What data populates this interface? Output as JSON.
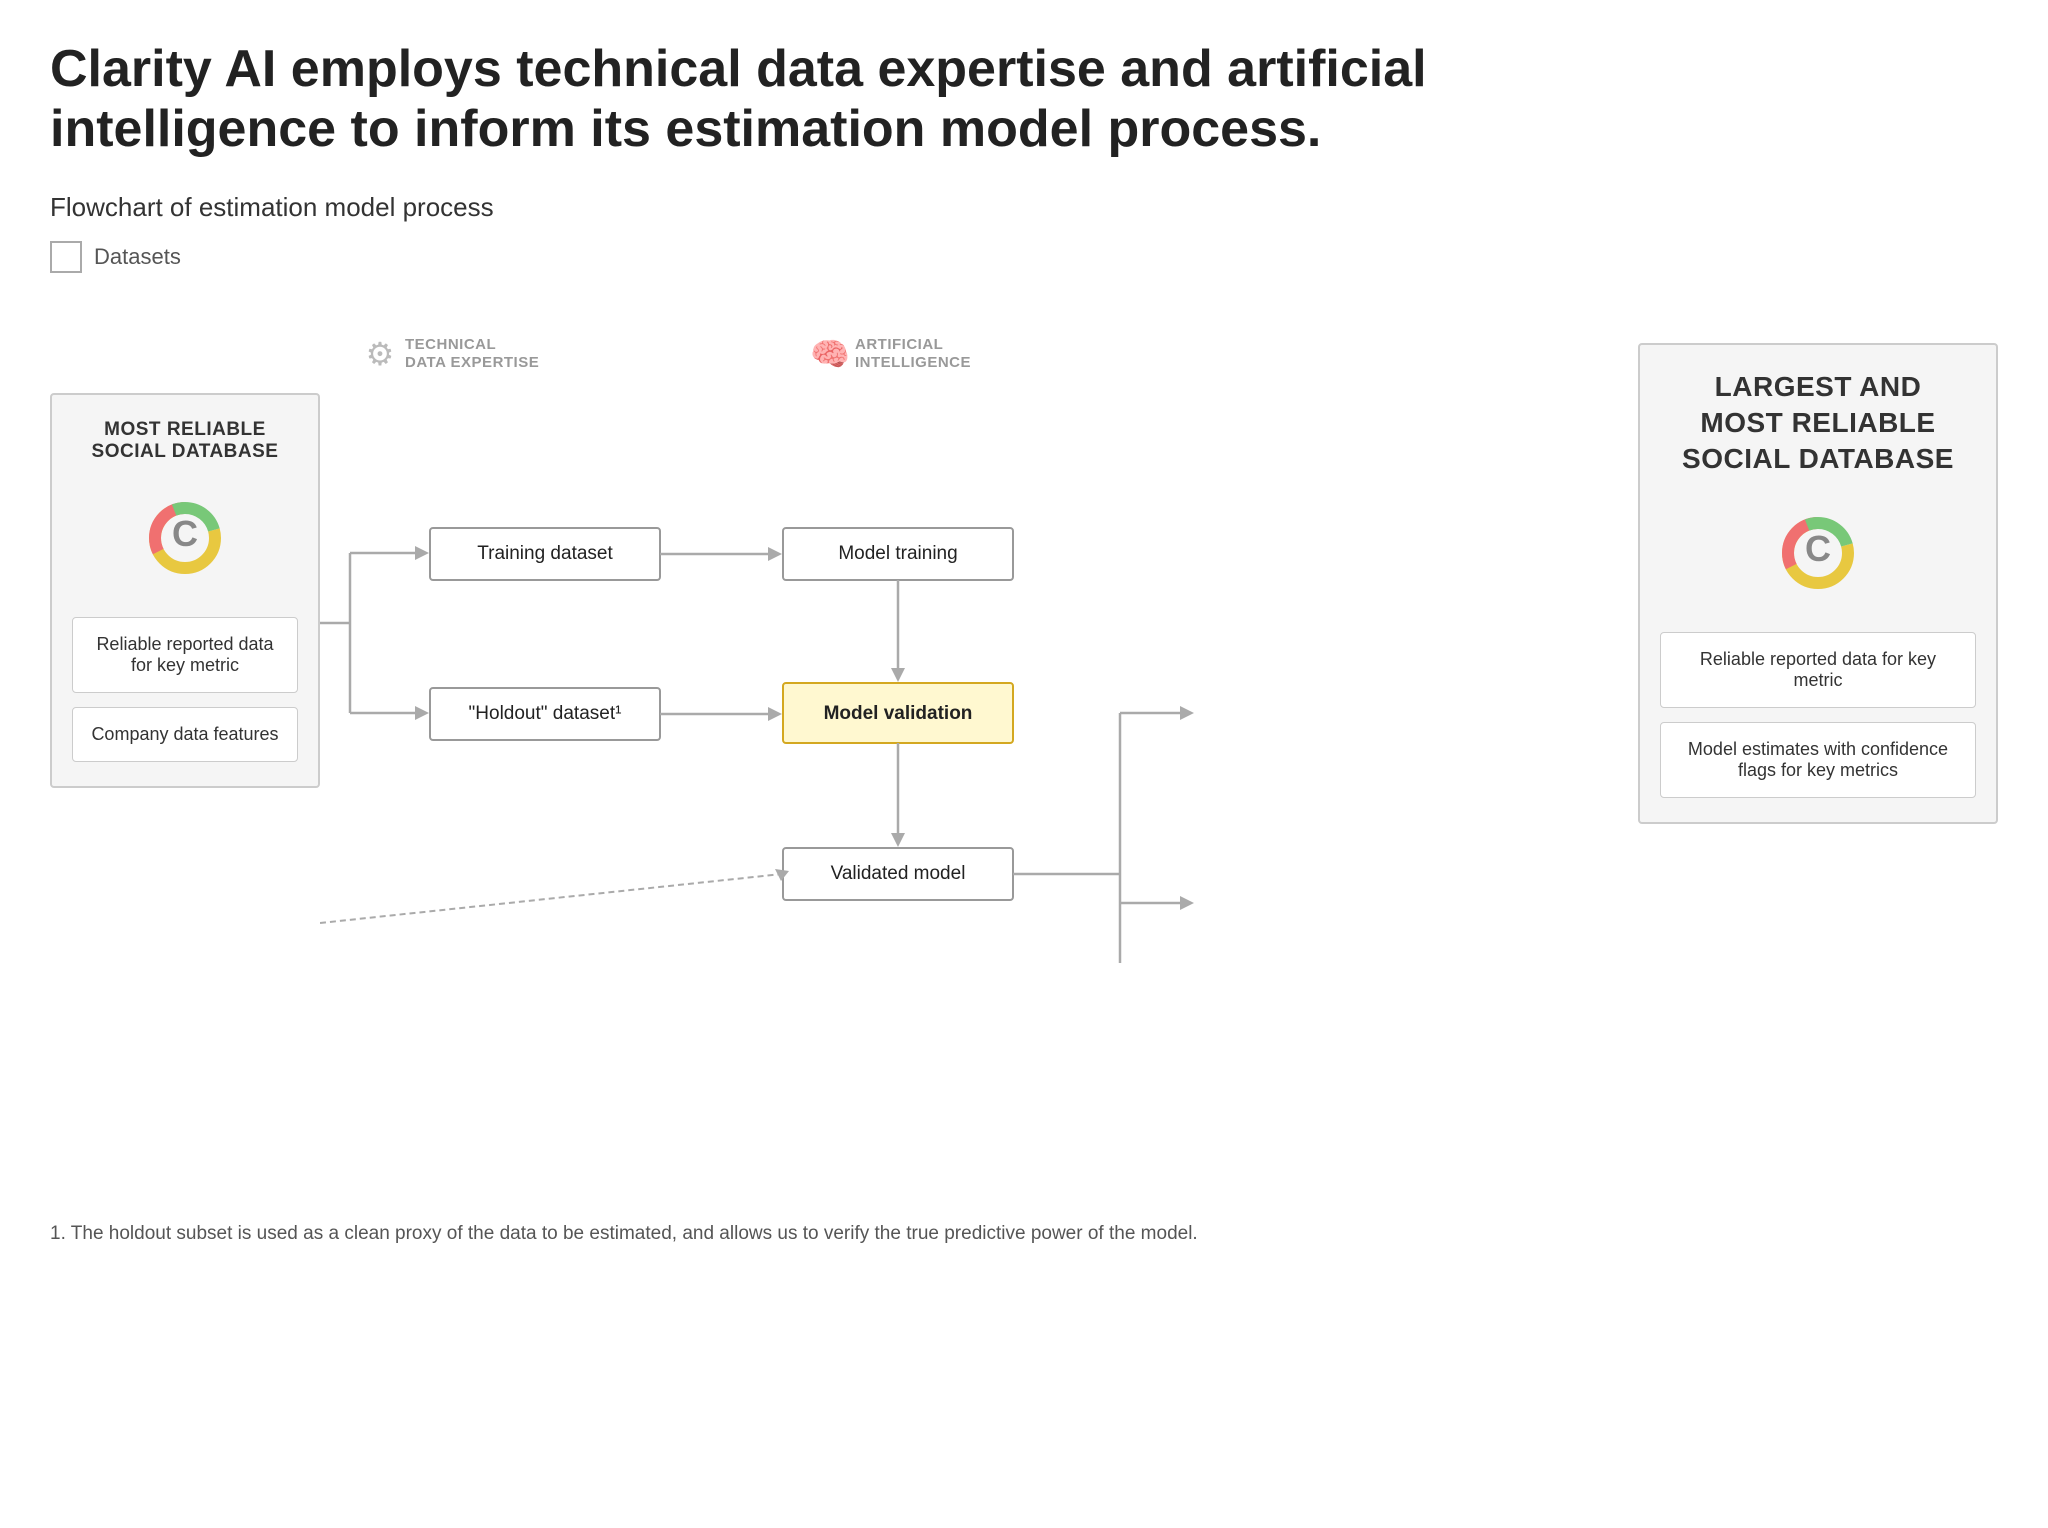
{
  "title": "Clarity AI employs technical data expertise and artificial intelligence to inform its estimation model process.",
  "subtitle": "Flowchart of estimation model process",
  "legend": {
    "label": "Datasets"
  },
  "left_panel": {
    "title": "MOST RELIABLE\nSOCIAL DATABASE",
    "items": [
      "Reliable reported data for key metric",
      "Company data features"
    ]
  },
  "right_panel": {
    "title": "LARGEST AND\nMOST RELIABLE\nSOCIAL DATABASE",
    "items": [
      "Reliable reported data for key metric",
      "Model estimates with confidence flags for key metrics"
    ]
  },
  "process_labels": {
    "technical": "TECHNICAL\nDATA EXPERTISE",
    "ai": "ARTIFICIAL\nINTELLIGENCE"
  },
  "flow_boxes": {
    "training": "Training dataset",
    "holdout": "“Holdout” dataset¹",
    "model_training": "Model training",
    "model_validation": "Model validation",
    "validated_model": "Validated model"
  },
  "footnote": "1. The holdout subset is used as a clean proxy of the data to be estimated, and allows us to verify the true predictive power of the model."
}
